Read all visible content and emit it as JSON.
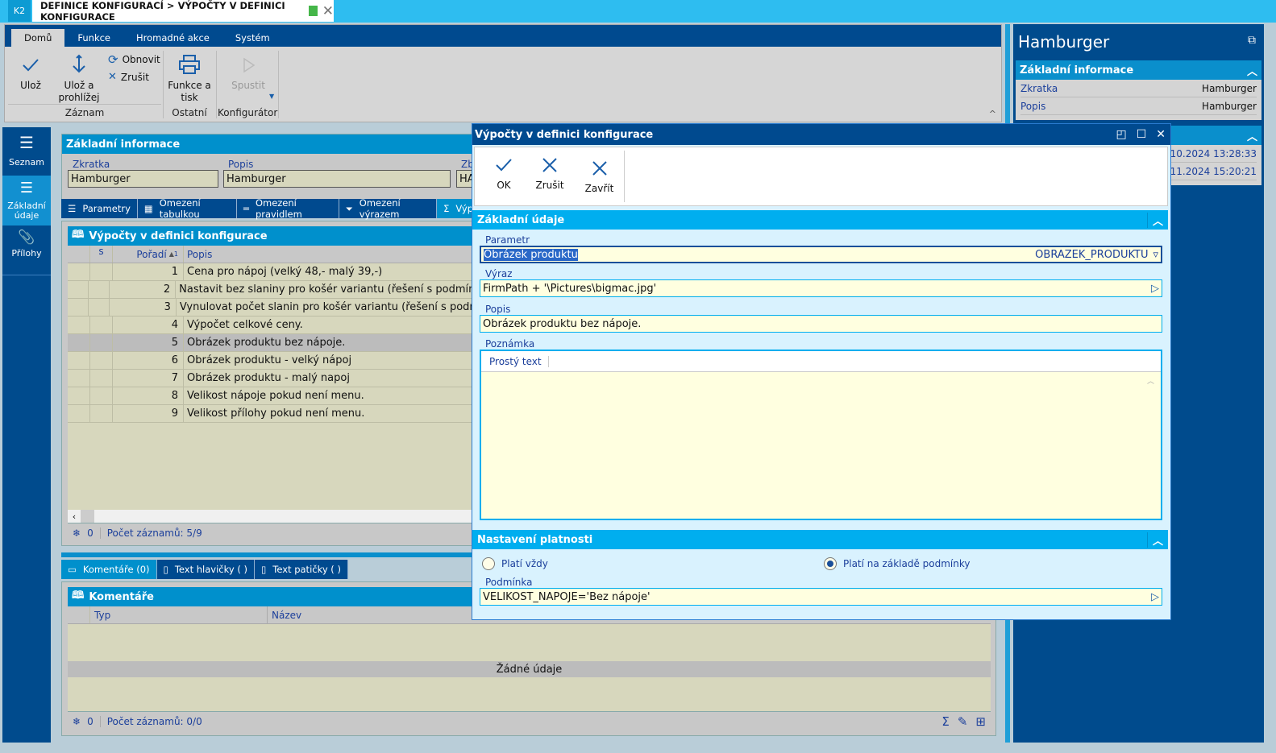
{
  "app": {
    "logo": "K2",
    "tab_title": "DEFINICE KONFIGURACÍ > VÝPOČTY V DEFINICI KONFIGURACE",
    "tab_status_color": "#45b649"
  },
  "ribbon": {
    "tabs": [
      "Domů",
      "Funkce",
      "Hromadné akce",
      "Systém"
    ],
    "save": "Ulož",
    "save_browse": "Ulož a prohlížej",
    "refresh": "Obnovit",
    "cancel": "Zrušit",
    "print": "Funkce a tisk",
    "run": "Spustit",
    "groups": [
      "Záznam",
      "Ostatní",
      "Konfigurátor"
    ]
  },
  "sidebar": {
    "items": [
      {
        "label": "Seznam",
        "icon": "menu-icon"
      },
      {
        "label": "Základní údaje",
        "icon": "list-icon"
      },
      {
        "label": "Přílohy",
        "icon": "paperclip-icon"
      }
    ]
  },
  "basic": {
    "title": "Základní informace",
    "zkratka_label": "Zkratka",
    "zkratka": "Hamburger",
    "popis_label": "Popis",
    "popis": "Hamburger",
    "zb_label": "Zb",
    "zb": "HA"
  },
  "subtabs": [
    "Parametry",
    "Omezení tabulkou",
    "Omezení pravidlem",
    "Omezení výrazem",
    "Výp"
  ],
  "grid": {
    "title": "Výpočty v definici konfigurace",
    "columns": [
      "s",
      "Pořadí",
      "Popis"
    ],
    "sort_index": "1",
    "rows": [
      {
        "n": "1",
        "popis": "Cena pro nápoj (velký 48,- malý 39,-)"
      },
      {
        "n": "2",
        "popis": "Nastavit bez slaniny pro košér variantu (řešení s podmínkou k"
      },
      {
        "n": "3",
        "popis": "Vynulovat počet slanin pro košér variantu (řešení s podmínko"
      },
      {
        "n": "4",
        "popis": "Výpočet celkové ceny."
      },
      {
        "n": "5",
        "popis": "Obrázek produktu bez nápoje."
      },
      {
        "n": "6",
        "popis": "Obrázek produktu - velký nápoj"
      },
      {
        "n": "7",
        "popis": "Obrázek produktu - malý napoj"
      },
      {
        "n": "8",
        "popis": "Velikost nápoje pokud není menu."
      },
      {
        "n": "9",
        "popis": "Velikost přílohy pokud není menu."
      }
    ],
    "selected": "5",
    "status_count": "0",
    "status_text": "Počet záznamů: 5/9"
  },
  "bottomtabs": [
    "Komentáře (0)",
    "Text hlavičky ( )",
    "Text patičky ( )"
  ],
  "comments": {
    "title": "Komentáře",
    "columns": [
      "Typ",
      "Název"
    ],
    "empty": "Žádné údaje",
    "status_count": "0",
    "status_text": "Počet záznamů: 0/0"
  },
  "right": {
    "title": "Hamburger",
    "section": "Základní informace",
    "rows": [
      {
        "k": "Zkratka",
        "v": "Hamburger"
      },
      {
        "k": "Popis",
        "v": "Hamburger"
      }
    ],
    "dates": [
      "30.10.2024 13:28:33",
      "05.11.2024 15:20:21"
    ]
  },
  "dialog": {
    "title": "Výpočty v definici konfigurace",
    "ok": "OK",
    "cancel": "Zrušit",
    "close": "Zavřít",
    "section1": "Základní údaje",
    "parametr_label": "Parametr",
    "parametr": "Obrázek produktu",
    "parametr_code": "OBRAZEK_PRODUKTU",
    "vyraz_label": "Výraz",
    "vyraz": "FirmPath + '\\Pictures\\bigmac.jpg'",
    "popis_label": "Popis",
    "popis": "Obrázek produktu bez nápoje.",
    "poznamka_label": "Poznámka",
    "format": "Prostý text",
    "section2": "Nastavení platnosti",
    "opt_always": "Platí vždy",
    "opt_condition": "Platí na základě podmínky",
    "selected_option": "condition",
    "podminka_label": "Podmínka",
    "podminka": "VELIKOST_NAPOJE='Bez nápoje'"
  }
}
